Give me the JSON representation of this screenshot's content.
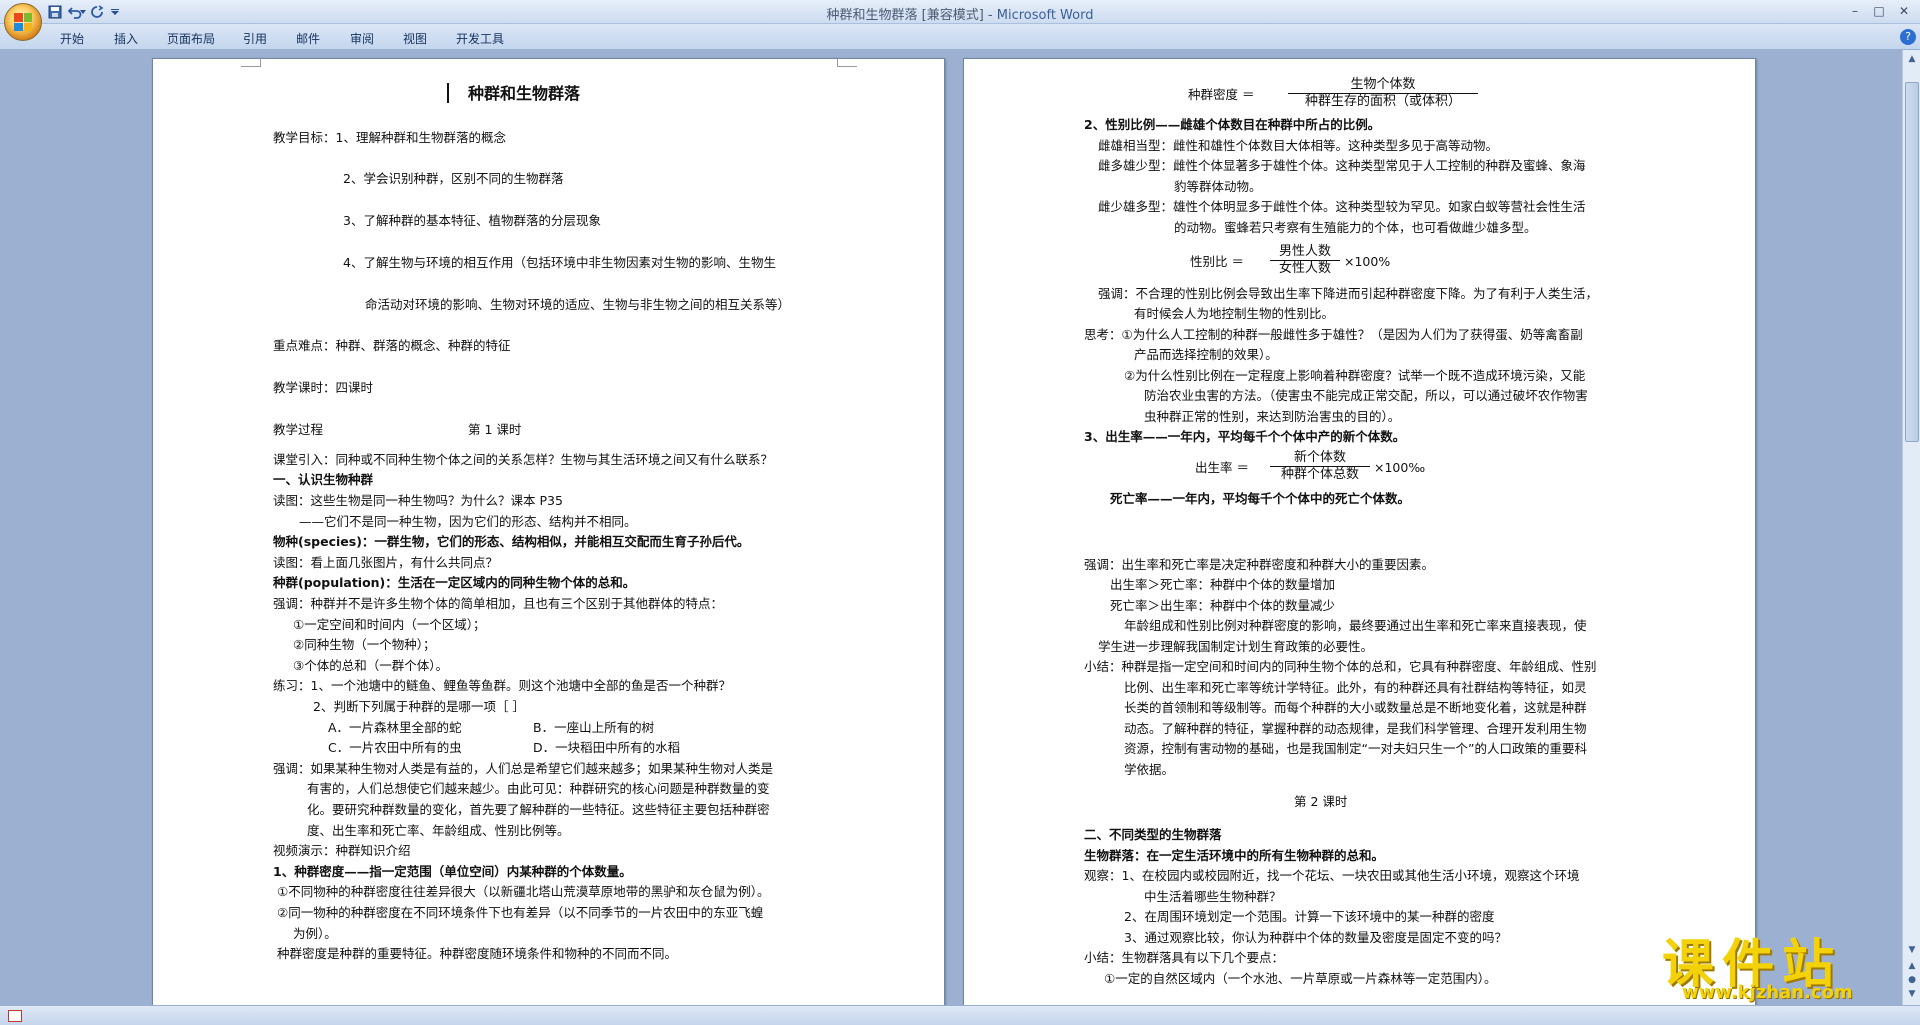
{
  "window": {
    "title": "种群和生物群落 [兼容模式] - ",
    "app_name": "Microsoft Word",
    "ctrl_min": "–",
    "ctrl_max": "□",
    "ctrl_close": "✕"
  },
  "ribbon": {
    "tabs": [
      "开始",
      "插入",
      "页面布局",
      "引用",
      "邮件",
      "审阅",
      "视图",
      "开发工具"
    ],
    "help": "?"
  },
  "colors": {
    "frame": "#9cb1d1",
    "ribbon": "#c4d6ee",
    "watermark": "#f4d20a"
  },
  "page1": {
    "title": "种群和生物群落",
    "lines": [
      "教学目标：1、理解种群和生物群落的概念",
      "2、学会识别种群，区别不同的生物群落",
      "3、了解种群的基本特征、植物群落的分层现象",
      "4、了解生物与环境的相互作用（包括环境中非生物因素对生物的影响、生物生",
      "命活动对环境的影响、生物对环境的适应、生物与非生物之间的相互关系等）",
      "重点难点：种群、群落的概念、种群的特征",
      "教学课时：四课时",
      "教学过程",
      "第 1 课时",
      "课堂引入：同种或不同种生物个体之间的关系怎样？生物与其生活环境之间又有什么联系？",
      "一、认识生物种群",
      "读图：这些生物是同一种生物吗？为什么？课本 P35",
      "——它们不是同一种生物，因为它们的形态、结构并不相同。",
      "物种(species)：一群生物，它们的形态、结构相似，并能相互交配而生育子孙后代。",
      "读图：看上面几张图片，有什么共同点？",
      "种群(population)：生活在一定区域内的同种生物个体的总和。",
      "强调：种群并不是许多生物个体的简单相加，且也有三个区别于其他群体的特点：",
      "①一定空间和时间内（一个区域）；",
      "②同种生物（一个物种）；",
      "③个体的总和（一群个体）。",
      "练习：1、一个池塘中的鲢鱼、鲤鱼等鱼群。则这个池塘中全部的鱼是否一个种群？",
      "2、判断下列属于种群的是哪一项［    ］",
      "A．一片森林里全部的蛇",
      "B．一座山上所有的树",
      "C．一片农田中所有的虫",
      "D．一块稻田中所有的水稻",
      "强调：如果某种生物对人类是有益的，人们总是希望它们越来越多；如果某种生物对人类是",
      "有害的，人们总想使它们越来越少。由此可见：种群研究的核心问题是种群数量的变",
      "化。要研究种群数量的变化，首先要了解种群的一些特征。这些特征主要包括种群密",
      "度、出生率和死亡率、年龄组成、性别比例等。",
      "视频演示：种群知识介绍",
      "1、种群密度——指一定范围（单位空间）内某种群的个体数量。",
      "①不同物种的种群密度往往差异很大（以新疆北塔山荒漠草原地带的黑驴和灰仓鼠为例）。",
      "②同一物种的种群密度在不同环境条件下也有差异（以不同季节的一片农田中的东亚飞蝗",
      "为例）。",
      "种群密度是种群的重要特征。种群密度随环境条件和物种的不同而不同。"
    ]
  },
  "page2": {
    "density_formula": {
      "label": "种群密度 ＝",
      "numerator": "生物个体数",
      "denominator": "种群生存的面积（或体积）"
    },
    "lines": [
      "2、性别比例——雌雄个体数目在种群中所占的比例。",
      "雌雄相当型：雌性和雄性个体数目大体相等。这种类型多见于高等动物。",
      "雌多雄少型：雌性个体显著多于雄性个体。这种类型常见于人工控制的种群及蜜蜂、象海",
      "豹等群体动物。",
      "雌少雄多型：雄性个体明显多于雌性个体。这种类型较为罕见。如家白蚁等营社会性生活",
      "的动物。蜜蜂若只考察有生殖能力的个体，也可看做雌少雄多型。",
      "强调：不合理的性别比例会导致出生率下降进而引起种群密度下降。为了有利于人类生活，",
      "有时候会人为地控制生物的性别比。",
      "思考：①为什么人工控制的种群一般雌性多于雄性？（是因为人们为了获得蛋、奶等禽畜副",
      "产品而选择控制的效果）。",
      "②为什么性别比例在一定程度上影响着种群密度？试举一个既不造成环境污染，又能",
      "防治农业虫害的方法。（使害虫不能完成正常交配，所以，可以通过破坏农作物害",
      "虫种群正常的性别，来达到防治害虫的目的）。",
      "3、出生率——一年内，平均每千个个体中产的新个体数。",
      "死亡率——一年内，平均每千个个体中的死亡个体数。",
      "强调：出生率和死亡率是决定种群密度和种群大小的重要因素。",
      "出生率＞死亡率：种群中个体的数量增加",
      "死亡率＞出生率：种群中个体的数量减少",
      "年龄组成和性别比例对种群密度的影响，最终要通过出生率和死亡率来直接表现，使",
      "学生进一步理解我国制定计划生育政策的必要性。",
      "小结：种群是指一定空间和时间内的同种生物个体的总和，它具有种群密度、年龄组成、性别",
      "比例、出生率和死亡率等统计学特征。此外，有的种群还具有社群结构等特征，如灵",
      "长类的首领制和等级制等。而每个种群的大小或数量总是不断地变化着，这就是种群",
      "动态。了解种群的特征，掌握种群的动态规律，是我们科学管理、合理开发利用生物",
      "资源，控制有害动物的基础，也是我国制定“一对夫妇只生一个”的人口政策的重要科",
      "学依据。",
      "第 2 课时",
      "二、不同类型的生物群落",
      "生物群落：在一定生活环境中的所有生物种群的总和。",
      "观察：1、在校园内或校园附近，找一个花坛、一块农田或其他生活小环境，观察这个环境",
      "中生活着哪些生物种群？",
      "2、在周围环境划定一个范围。计算一下该环境中的某一种群的密度",
      "3、通过观察比较，你认为种群中个体的数量及密度是固定不变的吗？",
      "小结：生物群落具有以下几个要点：",
      "①一定的自然区域内（一个水池、一片草原或一片森林等一定范围内）。"
    ],
    "sex_formula": {
      "label": "性别比 ＝",
      "numerator": "男性人数",
      "denominator": "女性人数",
      "suffix": "×100%"
    },
    "birth_formula": {
      "label": "出生率 ＝",
      "numerator": "新个体数",
      "denominator": "种群个体总数",
      "suffix": "×100‰"
    }
  },
  "watermark": {
    "main": "课件站",
    "url": "www.kjzhan.com"
  }
}
